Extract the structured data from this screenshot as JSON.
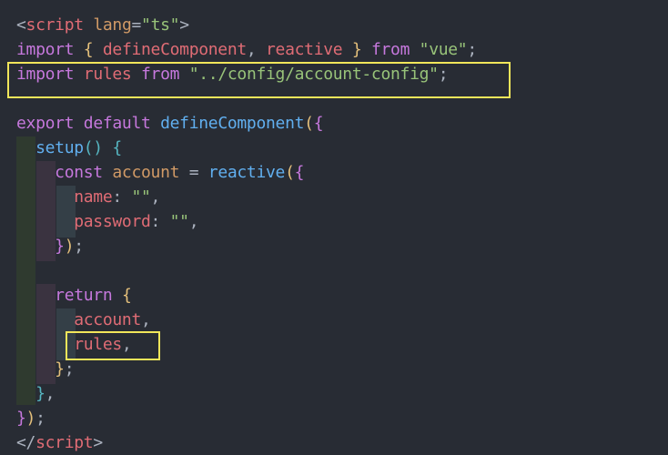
{
  "editor": {
    "theme_colors": {
      "background": "#282c34",
      "highlight_box": "#f1e65a",
      "tag": "#e06c75",
      "attribute": "#d19a66",
      "string": "#98c379",
      "keyword": "#c678dd",
      "function": "#61afef",
      "punctuation": "#abb2bf",
      "brace_level_1": "#e5c07b",
      "brace_level_2": "#c678dd",
      "brace_level_3": "#56b6c2"
    },
    "lines": [
      {
        "tokens": [
          {
            "t": "<",
            "c": "punc"
          },
          {
            "t": "script",
            "c": "tag"
          },
          {
            "t": " ",
            "c": "plain"
          },
          {
            "t": "lang",
            "c": "attr"
          },
          {
            "t": "=",
            "c": "punc"
          },
          {
            "t": "\"ts\"",
            "c": "str"
          },
          {
            "t": ">",
            "c": "punc"
          }
        ]
      },
      {
        "tokens": [
          {
            "t": "import",
            "c": "kw"
          },
          {
            "t": " ",
            "c": "plain"
          },
          {
            "t": "{",
            "c": "brace1"
          },
          {
            "t": " defineComponent",
            "c": "var"
          },
          {
            "t": ",",
            "c": "punc"
          },
          {
            "t": " reactive",
            "c": "var"
          },
          {
            "t": " ",
            "c": "plain"
          },
          {
            "t": "}",
            "c": "brace1"
          },
          {
            "t": " ",
            "c": "plain"
          },
          {
            "t": "from",
            "c": "kw"
          },
          {
            "t": " ",
            "c": "plain"
          },
          {
            "t": "\"vue\"",
            "c": "str"
          },
          {
            "t": ";",
            "c": "punc"
          }
        ]
      },
      {
        "tokens": [
          {
            "t": "import",
            "c": "kw"
          },
          {
            "t": " ",
            "c": "plain"
          },
          {
            "t": "rules",
            "c": "var"
          },
          {
            "t": " ",
            "c": "plain"
          },
          {
            "t": "from",
            "c": "kw"
          },
          {
            "t": " ",
            "c": "plain"
          },
          {
            "t": "\"../config/account-config\"",
            "c": "str"
          },
          {
            "t": ";",
            "c": "punc"
          }
        ]
      },
      {
        "tokens": []
      },
      {
        "tokens": [
          {
            "t": "export",
            "c": "kw"
          },
          {
            "t": " ",
            "c": "plain"
          },
          {
            "t": "default",
            "c": "kw"
          },
          {
            "t": " ",
            "c": "plain"
          },
          {
            "t": "defineComponent",
            "c": "fn"
          },
          {
            "t": "(",
            "c": "brace1"
          },
          {
            "t": "{",
            "c": "brace2"
          }
        ]
      },
      {
        "tokens": [
          {
            "t": "  ",
            "c": "plain"
          },
          {
            "t": "setup",
            "c": "fn"
          },
          {
            "t": "()",
            "c": "brace3"
          },
          {
            "t": " ",
            "c": "plain"
          },
          {
            "t": "{",
            "c": "brace3"
          }
        ]
      },
      {
        "tokens": [
          {
            "t": "    ",
            "c": "plain"
          },
          {
            "t": "const",
            "c": "kw"
          },
          {
            "t": " ",
            "c": "plain"
          },
          {
            "t": "account",
            "c": "attr"
          },
          {
            "t": " = ",
            "c": "punc"
          },
          {
            "t": "reactive",
            "c": "fn"
          },
          {
            "t": "(",
            "c": "brace1"
          },
          {
            "t": "{",
            "c": "brace2"
          }
        ]
      },
      {
        "tokens": [
          {
            "t": "      ",
            "c": "plain"
          },
          {
            "t": "name",
            "c": "var"
          },
          {
            "t": ": ",
            "c": "punc"
          },
          {
            "t": "\"\"",
            "c": "str"
          },
          {
            "t": ",",
            "c": "punc"
          }
        ]
      },
      {
        "tokens": [
          {
            "t": "      ",
            "c": "plain"
          },
          {
            "t": "password",
            "c": "var"
          },
          {
            "t": ": ",
            "c": "punc"
          },
          {
            "t": "\"\"",
            "c": "str"
          },
          {
            "t": ",",
            "c": "punc"
          }
        ]
      },
      {
        "tokens": [
          {
            "t": "    ",
            "c": "plain"
          },
          {
            "t": "}",
            "c": "brace2"
          },
          {
            "t": ")",
            "c": "brace1"
          },
          {
            "t": ";",
            "c": "punc"
          }
        ]
      },
      {
        "tokens": []
      },
      {
        "tokens": [
          {
            "t": "    ",
            "c": "plain"
          },
          {
            "t": "return",
            "c": "kw"
          },
          {
            "t": " ",
            "c": "plain"
          },
          {
            "t": "{",
            "c": "brace1"
          }
        ]
      },
      {
        "tokens": [
          {
            "t": "      ",
            "c": "plain"
          },
          {
            "t": "account",
            "c": "var"
          },
          {
            "t": ",",
            "c": "punc"
          }
        ]
      },
      {
        "tokens": [
          {
            "t": "      ",
            "c": "plain"
          },
          {
            "t": "rules",
            "c": "var"
          },
          {
            "t": ",",
            "c": "punc"
          }
        ]
      },
      {
        "tokens": [
          {
            "t": "    ",
            "c": "plain"
          },
          {
            "t": "}",
            "c": "brace1"
          },
          {
            "t": ";",
            "c": "punc"
          }
        ]
      },
      {
        "tokens": [
          {
            "t": "  ",
            "c": "plain"
          },
          {
            "t": "}",
            "c": "brace3"
          },
          {
            "t": ",",
            "c": "punc"
          }
        ]
      },
      {
        "tokens": [
          {
            "t": "}",
            "c": "brace2"
          },
          {
            "t": ")",
            "c": "brace1"
          },
          {
            "t": ";",
            "c": "punc"
          }
        ]
      },
      {
        "tokens": [
          {
            "t": "</",
            "c": "punc"
          },
          {
            "t": "script",
            "c": "tag"
          },
          {
            "t": ">",
            "c": "punc"
          }
        ]
      }
    ]
  }
}
